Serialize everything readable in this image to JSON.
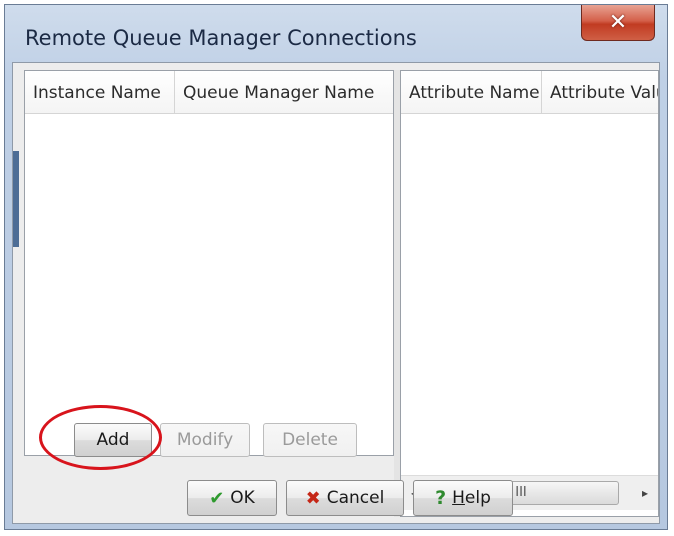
{
  "window": {
    "title": "Remote Queue Manager Connections",
    "close_icon": "close-icon",
    "close_glyph": "✕"
  },
  "left_table": {
    "columns": [
      "Instance Name",
      "Queue Manager Name"
    ],
    "rows": []
  },
  "right_table": {
    "columns": [
      "Attribute Name",
      "Attribute Valu"
    ],
    "rows": [],
    "scrollbar": {
      "left_icon": "scroll-left-icon",
      "left_glyph": "◂",
      "right_icon": "scroll-right-icon",
      "right_glyph": "▸",
      "grip_glyph": "III"
    }
  },
  "actions": {
    "add_label": "Add",
    "modify_label": "Modify",
    "delete_label": "Delete"
  },
  "footer": {
    "ok_label": "OK",
    "ok_icon": "check-icon",
    "ok_glyph": "✔",
    "cancel_label": "Cancel",
    "cancel_icon": "x-icon",
    "cancel_glyph": "✖",
    "help_prefix": "H",
    "help_rest": "elp",
    "help_icon": "question-icon",
    "help_glyph": "?"
  },
  "annotation": {
    "highlight_color": "#d8141c"
  },
  "colors": {
    "title_bar": "#bfd0e6",
    "close_button": "#c13b22"
  }
}
